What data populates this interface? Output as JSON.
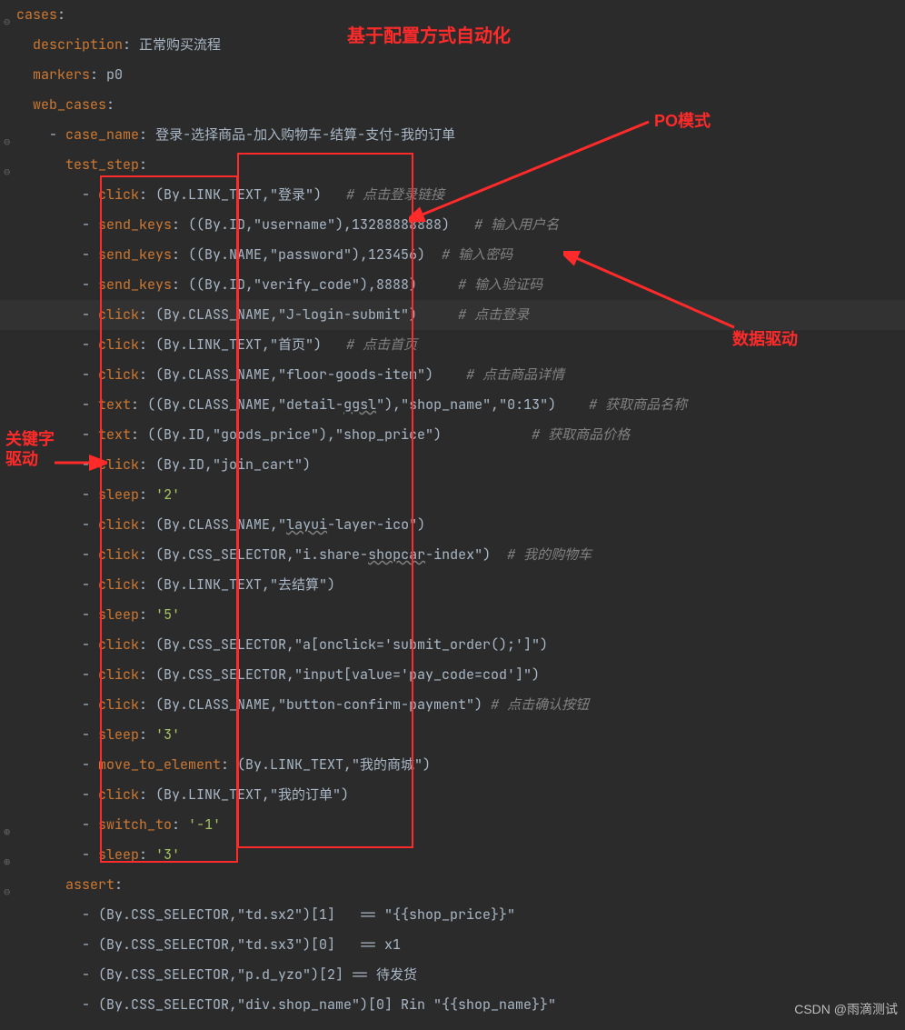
{
  "code_lines": [
    {
      "indent": 0,
      "segs": [
        {
          "t": "cases",
          "c": "k-key"
        },
        {
          "t": ":",
          "c": "k-txt"
        }
      ]
    },
    {
      "indent": 1,
      "segs": [
        {
          "t": "description",
          "c": "k-key"
        },
        {
          "t": ": ",
          "c": "k-txt"
        },
        {
          "t": "正常购买流程",
          "c": "k-txt"
        }
      ]
    },
    {
      "indent": 1,
      "segs": [
        {
          "t": "markers",
          "c": "k-key"
        },
        {
          "t": ": ",
          "c": "k-txt"
        },
        {
          "t": "p0",
          "c": "k-txt"
        }
      ]
    },
    {
      "indent": 1,
      "segs": [
        {
          "t": "web_cases",
          "c": "k-key"
        },
        {
          "t": ":",
          "c": "k-txt"
        }
      ]
    },
    {
      "indent": 2,
      "dash": true,
      "segs": [
        {
          "t": "case_name",
          "c": "k-key"
        },
        {
          "t": ": ",
          "c": "k-txt"
        },
        {
          "t": "登录-选择商品-加入购物车-结算-支付-我的订单",
          "c": "k-txt"
        }
      ]
    },
    {
      "indent": 3,
      "segs": [
        {
          "t": "test_step",
          "c": "k-key"
        },
        {
          "t": ":",
          "c": "k-txt"
        }
      ]
    },
    {
      "indent": 4,
      "dash": true,
      "segs": [
        {
          "t": "click",
          "c": "k-key"
        },
        {
          "t": ": (By.LINK_TEXT,\"登录\")   ",
          "c": "k-txt"
        },
        {
          "t": "# 点击登录链接",
          "c": "k-cmt"
        }
      ]
    },
    {
      "indent": 4,
      "dash": true,
      "segs": [
        {
          "t": "send_keys",
          "c": "k-key"
        },
        {
          "t": ": ((By.ID,\"username\"),13288888888)   ",
          "c": "k-txt"
        },
        {
          "t": "# 输入用户名",
          "c": "k-cmt"
        }
      ]
    },
    {
      "indent": 4,
      "dash": true,
      "segs": [
        {
          "t": "send_keys",
          "c": "k-key"
        },
        {
          "t": ": ((By.NAME,\"password\"),123456)  ",
          "c": "k-txt"
        },
        {
          "t": "# 输入密码",
          "c": "k-cmt"
        }
      ]
    },
    {
      "indent": 4,
      "dash": true,
      "segs": [
        {
          "t": "send_keys",
          "c": "k-key"
        },
        {
          "t": ": ((By.ID,\"verify_code\"),8888)     ",
          "c": "k-txt"
        },
        {
          "t": "# 输入验证码",
          "c": "k-cmt"
        }
      ]
    },
    {
      "indent": 4,
      "dash": true,
      "hl": true,
      "segs": [
        {
          "t": "click",
          "c": "k-key"
        },
        {
          "t": ": (By.CLASS_NAME,\"J-login-submit\")     ",
          "c": "k-txt"
        },
        {
          "t": "# 点击登录",
          "c": "k-cmt"
        }
      ]
    },
    {
      "indent": 4,
      "dash": true,
      "segs": [
        {
          "t": "click",
          "c": "k-key"
        },
        {
          "t": ": (By.LINK_TEXT,\"首页\")   ",
          "c": "k-txt"
        },
        {
          "t": "# 点击首页",
          "c": "k-cmt"
        }
      ]
    },
    {
      "indent": 4,
      "dash": true,
      "segs": [
        {
          "t": "click",
          "c": "k-key"
        },
        {
          "t": ": (By.CLASS_NAME,\"floor-goods-item\")    ",
          "c": "k-txt"
        },
        {
          "t": "# 点击商品详情",
          "c": "k-cmt"
        }
      ]
    },
    {
      "indent": 4,
      "dash": true,
      "segs": [
        {
          "t": "text",
          "c": "k-key"
        },
        {
          "t": ": ((By.CLASS_NAME,\"detail-",
          "c": "k-txt"
        },
        {
          "t": "ggsl",
          "c": "k-txt wavy"
        },
        {
          "t": "\"),\"shop_name\",\"0:13\")    ",
          "c": "k-txt"
        },
        {
          "t": "# 获取商品名称",
          "c": "k-cmt"
        }
      ]
    },
    {
      "indent": 4,
      "dash": true,
      "segs": [
        {
          "t": "text",
          "c": "k-key"
        },
        {
          "t": ": ((By.ID,\"goods_price\"),\"shop_price\")           ",
          "c": "k-txt"
        },
        {
          "t": "# 获取商品价格",
          "c": "k-cmt"
        }
      ]
    },
    {
      "indent": 4,
      "dash": true,
      "segs": [
        {
          "t": "click",
          "c": "k-key"
        },
        {
          "t": ": (By.ID,\"join_cart\")",
          "c": "k-txt"
        }
      ]
    },
    {
      "indent": 4,
      "dash": true,
      "segs": [
        {
          "t": "sleep",
          "c": "k-key"
        },
        {
          "t": ": ",
          "c": "k-txt"
        },
        {
          "t": "'2'",
          "c": "k-str"
        }
      ]
    },
    {
      "indent": 4,
      "dash": true,
      "segs": [
        {
          "t": "click",
          "c": "k-key"
        },
        {
          "t": ": (By.CLASS_NAME,\"",
          "c": "k-txt"
        },
        {
          "t": "layui",
          "c": "k-txt wavy"
        },
        {
          "t": "-layer-ico\")",
          "c": "k-txt"
        }
      ]
    },
    {
      "indent": 4,
      "dash": true,
      "segs": [
        {
          "t": "click",
          "c": "k-key"
        },
        {
          "t": ": (By.CSS_SELECTOR,\"i.share-",
          "c": "k-txt"
        },
        {
          "t": "shopcar",
          "c": "k-txt wavy"
        },
        {
          "t": "-index\")  ",
          "c": "k-txt"
        },
        {
          "t": "# 我的购物车",
          "c": "k-cmt"
        }
      ]
    },
    {
      "indent": 4,
      "dash": true,
      "segs": [
        {
          "t": "click",
          "c": "k-key"
        },
        {
          "t": ": (By.LINK_TEXT,\"去结算\")",
          "c": "k-txt"
        }
      ]
    },
    {
      "indent": 4,
      "dash": true,
      "segs": [
        {
          "t": "sleep",
          "c": "k-key"
        },
        {
          "t": ": ",
          "c": "k-txt"
        },
        {
          "t": "'5'",
          "c": "k-str"
        }
      ]
    },
    {
      "indent": 4,
      "dash": true,
      "segs": [
        {
          "t": "click",
          "c": "k-key"
        },
        {
          "t": ": (By.CSS_SELECTOR,\"a[onclick='submit_order();']\")",
          "c": "k-txt"
        }
      ]
    },
    {
      "indent": 4,
      "dash": true,
      "segs": [
        {
          "t": "click",
          "c": "k-key"
        },
        {
          "t": ": (By.CSS_SELECTOR,\"input[value='pay_code=cod']\")",
          "c": "k-txt"
        }
      ]
    },
    {
      "indent": 4,
      "dash": true,
      "segs": [
        {
          "t": "click",
          "c": "k-key"
        },
        {
          "t": ": (By.CLASS_NAME,\"button-confirm-payment\") ",
          "c": "k-txt"
        },
        {
          "t": "# 点击确认按钮",
          "c": "k-cmt"
        }
      ]
    },
    {
      "indent": 4,
      "dash": true,
      "segs": [
        {
          "t": "sleep",
          "c": "k-key"
        },
        {
          "t": ": ",
          "c": "k-txt"
        },
        {
          "t": "'3'",
          "c": "k-str"
        }
      ]
    },
    {
      "indent": 4,
      "dash": true,
      "segs": [
        {
          "t": "move_to_element",
          "c": "k-key"
        },
        {
          "t": ": (By.LINK_TEXT,\"我的商城\")",
          "c": "k-txt"
        }
      ]
    },
    {
      "indent": 4,
      "dash": true,
      "segs": [
        {
          "t": "click",
          "c": "k-key"
        },
        {
          "t": ": (By.LINK_TEXT,\"我的订单\")",
          "c": "k-txt"
        }
      ]
    },
    {
      "indent": 4,
      "dash": true,
      "segs": [
        {
          "t": "switch_to",
          "c": "k-key"
        },
        {
          "t": ": ",
          "c": "k-txt"
        },
        {
          "t": "'-1'",
          "c": "k-str"
        }
      ]
    },
    {
      "indent": 4,
      "dash": true,
      "segs": [
        {
          "t": "sleep",
          "c": "k-key"
        },
        {
          "t": ": ",
          "c": "k-txt"
        },
        {
          "t": "'3'",
          "c": "k-str"
        }
      ]
    },
    {
      "indent": 3,
      "segs": [
        {
          "t": "assert",
          "c": "k-key"
        },
        {
          "t": ":",
          "c": "k-txt"
        }
      ]
    },
    {
      "indent": 4,
      "dash": true,
      "segs": [
        {
          "t": "(By.CSS_SELECTOR,\"td.sx2\")[1]   == \"{{shop_price}}\"",
          "c": "k-txt"
        }
      ]
    },
    {
      "indent": 4,
      "dash": true,
      "segs": [
        {
          "t": "(By.CSS_SELECTOR,\"td.sx3\")[0]   == x1",
          "c": "k-txt"
        }
      ]
    },
    {
      "indent": 4,
      "dash": true,
      "segs": [
        {
          "t": "(By.CSS_SELECTOR,\"p.d_yzo\")[2] == 待发货",
          "c": "k-txt"
        }
      ]
    },
    {
      "indent": 4,
      "dash": true,
      "segs": [
        {
          "t": "(By.CSS_SELECTOR,\"div.shop_name\")[0] Rin \"{{shop_name}}\"",
          "c": "k-txt"
        }
      ]
    }
  ],
  "gutter": [
    {
      "line": 0,
      "t": "⊖"
    },
    {
      "line": 4,
      "t": "⊖"
    },
    {
      "line": 5,
      "t": "⊖"
    },
    {
      "line": 27,
      "t": "⊕"
    },
    {
      "line": 28,
      "t": "⊕"
    },
    {
      "line": 29,
      "t": "⊖"
    }
  ],
  "annotations": {
    "title_top": "基于配置方式自动化",
    "po_mode": "PO模式",
    "data_driven": "数据驱动",
    "keyword_driven_1": "关键字",
    "keyword_driven_2": "驱动"
  },
  "watermark": "CSDN @雨滴测试"
}
